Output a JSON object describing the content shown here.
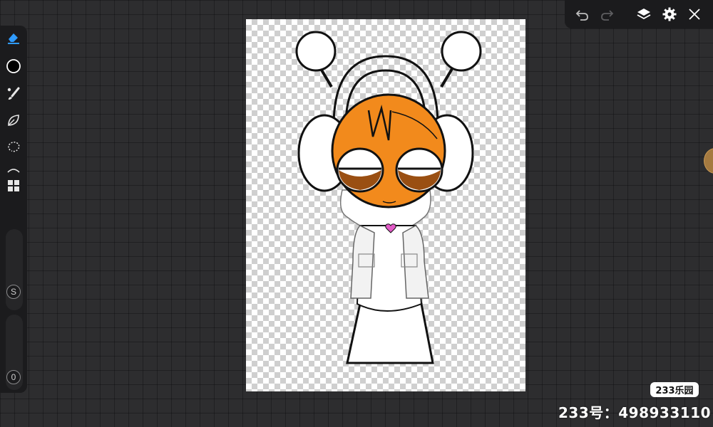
{
  "left_toolbar": {
    "tools": [
      {
        "name": "eraser-tool",
        "icon": "eraser-icon",
        "active": true
      },
      {
        "name": "color-picker",
        "icon": "color-swatch-icon",
        "color": "#000000"
      },
      {
        "name": "brush-tool",
        "icon": "brush-icon"
      },
      {
        "name": "smudge-tool",
        "icon": "leaf-icon"
      },
      {
        "name": "lasso-tool",
        "icon": "lasso-icon"
      },
      {
        "name": "curve-tool",
        "icon": "curve-icon"
      },
      {
        "name": "layout-tool",
        "icon": "grid-icon"
      }
    ],
    "size_slider": {
      "label": "S"
    },
    "opacity_slider": {
      "label": "0"
    }
  },
  "top_toolbar": {
    "buttons": [
      "undo-icon",
      "redo-icon",
      "layers-icon",
      "settings-icon",
      "close-icon"
    ]
  },
  "colors": {
    "accent": "#2f9bff",
    "toolbar_bg": "#1b1b1d",
    "canvas_skin": "#f28a1c",
    "eyes": "#9a4f12",
    "heart": "#e25bc7"
  },
  "watermark": {
    "brand": "233乐园",
    "id_text": "233号：498933110"
  }
}
